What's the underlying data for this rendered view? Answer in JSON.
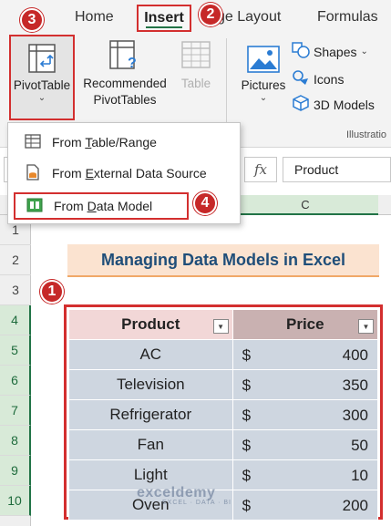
{
  "ribbon": {
    "tabs": [
      "Home",
      "Insert",
      "ge Layout",
      "Formulas"
    ],
    "buttons": {
      "pivottable": "PivotTable",
      "recommended_line1": "Recommended",
      "recommended_line2": "PivotTables",
      "table": "Table",
      "pictures": "Pictures",
      "shapes": "Shapes",
      "icons": "Icons",
      "models3d": "3D Models"
    },
    "group_label": "Illustratio"
  },
  "steps": {
    "one": "1",
    "two": "2",
    "three": "3",
    "four": "4"
  },
  "menu": {
    "items": [
      {
        "pre": "From ",
        "acc": "T",
        "post": "able/Range"
      },
      {
        "pre": "From ",
        "acc": "E",
        "post": "xternal Data Source"
      },
      {
        "pre": "From ",
        "acc": "D",
        "post": "ata Model"
      }
    ]
  },
  "formula_bar": {
    "fx": "fx",
    "value": "Product"
  },
  "column_header": "C",
  "row_numbers": [
    "1",
    "2",
    "3",
    "4",
    "5",
    "6",
    "7",
    "8",
    "9",
    "10"
  ],
  "sheet": {
    "title": "Managing Data Models in Excel",
    "headers": [
      "Product",
      "Price"
    ],
    "currency": "$",
    "rows": [
      {
        "product": "AC",
        "price": "400"
      },
      {
        "product": "Television",
        "price": "350"
      },
      {
        "product": "Refrigerator",
        "price": "300"
      },
      {
        "product": "Fan",
        "price": "50"
      },
      {
        "product": "Light",
        "price": "10"
      },
      {
        "product": "Oven",
        "price": "200"
      }
    ]
  },
  "watermark": {
    "brand": "exceldemy",
    "tagline": "EXCEL · DATA · BI"
  },
  "colors": {
    "highlight": "#d32f2f",
    "excel_green": "#217346",
    "title_text": "#1f4e79"
  }
}
